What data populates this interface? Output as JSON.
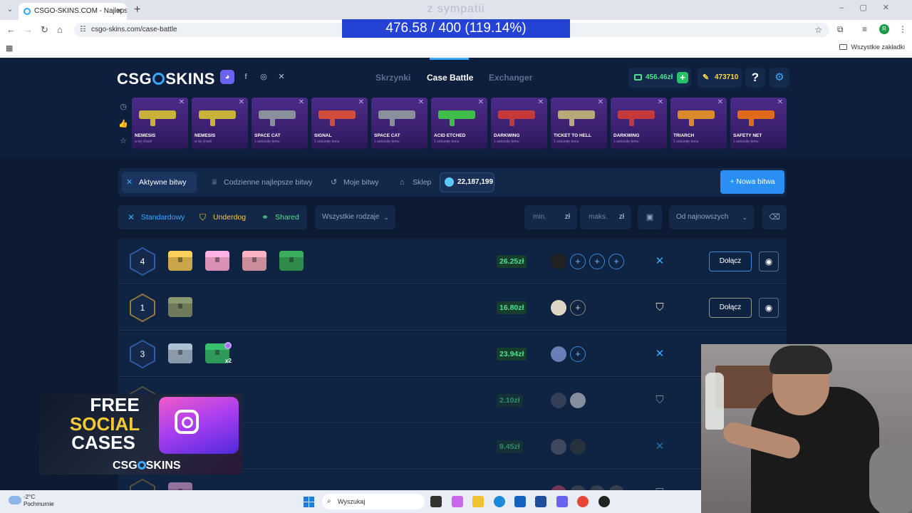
{
  "browser": {
    "tab_title": "CSGO-SKINS.COM - Najlepsze",
    "url": "csgo-skins.com/case-battle",
    "all_bookmarks": "Wszystkie zakładki",
    "profile_initial": "R"
  },
  "stream": {
    "title": "z sympatii",
    "banner": "476.58 / 400 (119.14%)"
  },
  "site": {
    "logo_left": "CSG",
    "logo_right": "SKINS",
    "nav": [
      "Skrzynki",
      "Case Battle",
      "Exchanger"
    ],
    "balance": "456.46zł",
    "coins": "473710",
    "help": "?"
  },
  "drops": [
    {
      "name": "NEMESIS",
      "time": "w tej chwili",
      "color": "#c9b23a"
    },
    {
      "name": "NEMESIS",
      "time": "w tej chwili",
      "color": "#c9b23a"
    },
    {
      "name": "SPACE CAT",
      "time": "1 sekundę temu",
      "color": "#8a8f9c"
    },
    {
      "name": "SIGNAL",
      "time": "1 sekundę temu",
      "color": "#d24c3c"
    },
    {
      "name": "SPACE CAT",
      "time": "1 sekundę temu",
      "color": "#8a8f9c"
    },
    {
      "name": "ACID ETCHED",
      "time": "1 sekundę temu",
      "color": "#3fbf4a"
    },
    {
      "name": "DARKWING",
      "time": "1 sekundę temu",
      "color": "#c43a3a"
    },
    {
      "name": "TICKET TO HELL",
      "time": "1 sekundę temu",
      "color": "#b9a878"
    },
    {
      "name": "DARKWING",
      "time": "1 sekundę temu",
      "color": "#c43a3a"
    },
    {
      "name": "TRIARCH",
      "time": "1 sekundę temu",
      "color": "#d98a2a"
    },
    {
      "name": "SAFETY NET",
      "time": "1 sekundę temu",
      "color": "#e06a1a"
    }
  ],
  "tabs": {
    "active": "Aktywne bitwy",
    "daily": "Codzienne najlepsze bitwy",
    "mine": "Moje bitwy",
    "shop": "Sklep",
    "gems": "22,187,199",
    "new_battle": "+ Nowa bitwa"
  },
  "filters": {
    "standard": "Standardowy",
    "underdog": "Underdog",
    "shared": "Shared",
    "all_types": "Wszystkie rodzaje",
    "min": "min.",
    "max": "maks.",
    "unit": "zł",
    "sort": "Od najnowszych"
  },
  "battles": [
    {
      "players": "4",
      "price": "26.25zł",
      "mode": "standard",
      "join": "Dołącz",
      "cases": [
        "#c9a64a",
        "#d98fb6",
        "#c98e9a",
        "#2e8b4a"
      ],
      "mult": "",
      "badge": false
    },
    {
      "players": "1",
      "price": "16.80zł",
      "mode": "underdog",
      "join": "Dołącz",
      "cases": [
        "#6f7a5a"
      ],
      "mult": "",
      "badge": false
    },
    {
      "players": "3",
      "price": "23.94zł",
      "mode": "standard",
      "join": "",
      "cases": [
        "#8a9aaa",
        "#2e9a5a"
      ],
      "mult": "x2",
      "badge": true
    },
    {
      "players": "",
      "price": "2.10zł",
      "mode": "underdog",
      "join": "",
      "cases": [],
      "mult": "",
      "badge": false
    },
    {
      "players": "",
      "price": "9.45zł",
      "mode": "standard",
      "join": "",
      "cases": [],
      "mult": "",
      "badge": false
    },
    {
      "players": "",
      "price": "",
      "mode": "underdog",
      "join": "",
      "cases": [
        "#d98fb6"
      ],
      "mult": "",
      "badge": false
    }
  ],
  "promo": {
    "line1": "FREE",
    "line2": "SOCIAL",
    "line3": "CASES",
    "logo_left": "CSG",
    "logo_right": "SKINS"
  },
  "taskbar": {
    "temp": "-2°C",
    "weather": "Pochmurnie",
    "search": "Wyszukaj"
  }
}
